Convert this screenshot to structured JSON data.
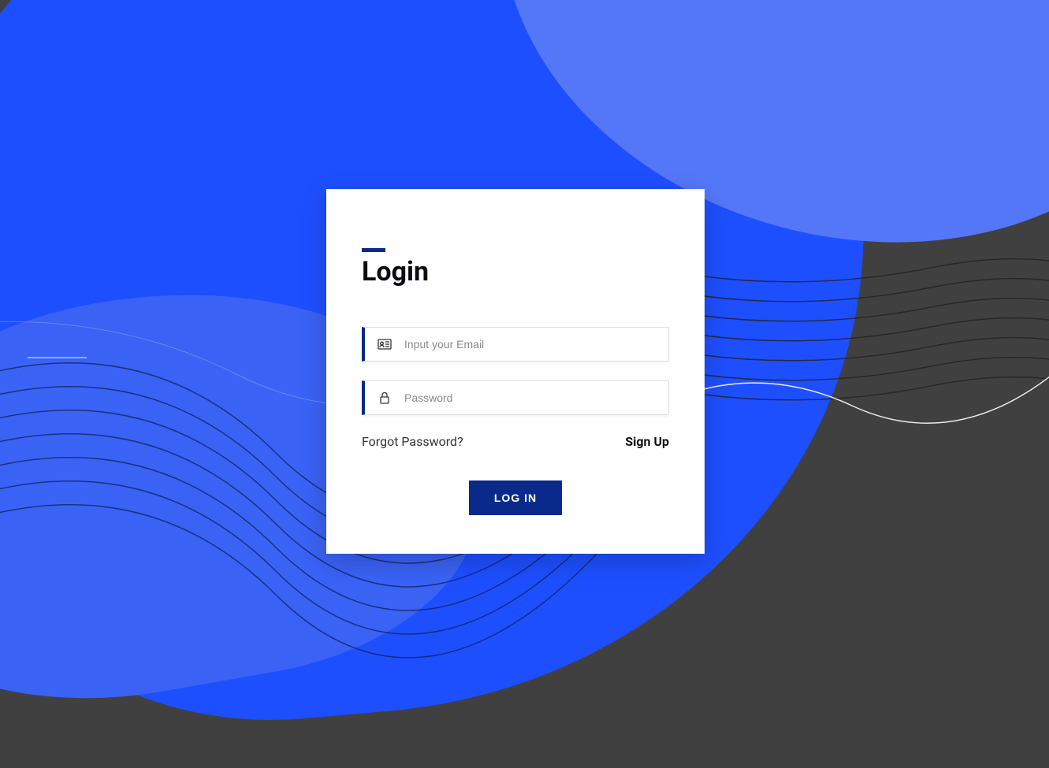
{
  "login": {
    "title": "Login",
    "email_placeholder": "Input your Email",
    "password_placeholder": "Password",
    "forgot_password_label": "Forgot Password?",
    "signup_label": "Sign Up",
    "login_button_label": "LOG IN"
  },
  "colors": {
    "primary_blue": "#1e4fff",
    "dark_blue": "#0a2a8b",
    "background_gray": "#404040"
  }
}
